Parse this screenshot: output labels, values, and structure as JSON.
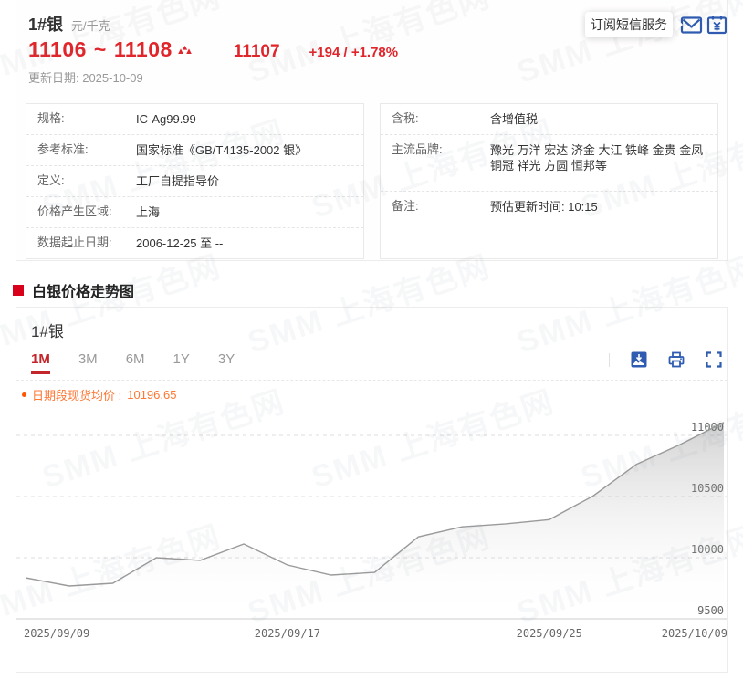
{
  "watermark": {
    "text": "SMM 上海有色网"
  },
  "header": {
    "product": "1#银",
    "unit": "元/千克",
    "price_low": "11106",
    "separator": "~",
    "price_high": "11108",
    "avg_price": "11107",
    "change": "+194  /  +1.78%",
    "update": "更新日期: 2025-10-09"
  },
  "subscribe": {
    "tooltip": "订阅短信服务"
  },
  "info_left": {
    "rows": [
      {
        "label": "规格:",
        "value": "IC-Ag99.99"
      },
      {
        "label": "参考标准:",
        "value": "国家标准《GB/T4135-2002 银》"
      },
      {
        "label": "定义:",
        "value": "工厂自提指导价"
      },
      {
        "label": "价格产生区域:",
        "value": "上海"
      },
      {
        "label": "数据起止日期:",
        "value": "2006-12-25 至 --"
      }
    ]
  },
  "info_right": {
    "rows": [
      {
        "label": "含税:",
        "value": "含增值税"
      },
      {
        "label": "主流品牌:",
        "value": "豫光 万洋 宏达 济金 大江 铁峰 金贵 金凤 铜冠 祥光 方圆 恒邦等"
      },
      {
        "label": "备注:",
        "value": "预估更新时间: 10:15"
      }
    ]
  },
  "section": {
    "title": "白银价格走势图"
  },
  "chart_card": {
    "title": "1#银",
    "tabs": [
      {
        "label": "1M",
        "active": true
      },
      {
        "label": "3M",
        "active": false
      },
      {
        "label": "6M",
        "active": false
      },
      {
        "label": "1Y",
        "active": false
      },
      {
        "label": "3Y",
        "active": false
      }
    ],
    "legend_label": "日期段现货均价 :",
    "legend_value": "10196.65"
  },
  "chart_data": {
    "type": "area",
    "title": "1#银 价格走势 (1M)",
    "x": [
      "2025/09/09",
      "2025/09/10",
      "2025/09/11",
      "2025/09/12",
      "2025/09/15",
      "2025/09/16",
      "2025/09/17",
      "2025/09/18",
      "2025/09/19",
      "2025/09/22",
      "2025/09/23",
      "2025/09/24",
      "2025/09/25",
      "2025/09/26",
      "2025/09/29",
      "2025/09/30",
      "2025/10/09"
    ],
    "values": [
      9836,
      9769,
      9791,
      10000,
      9978,
      10112,
      9940,
      9858,
      9880,
      10170,
      10252,
      10277,
      10311,
      10504,
      10764,
      10925,
      11107
    ],
    "ylim": [
      9500,
      11290
    ],
    "y_ticks": [
      9500,
      10000,
      10500,
      11000
    ],
    "x_tick_indices": [
      0,
      6,
      12,
      16
    ],
    "xlabel": "",
    "ylabel": "元/千克",
    "grid": "horizontal-dashed",
    "legend_position": "top-left",
    "line_color": "#9a9a9a",
    "area_top_color": "rgba(125,125,125,0.35)",
    "area_bottom_color": "rgba(255,255,255,0)"
  }
}
